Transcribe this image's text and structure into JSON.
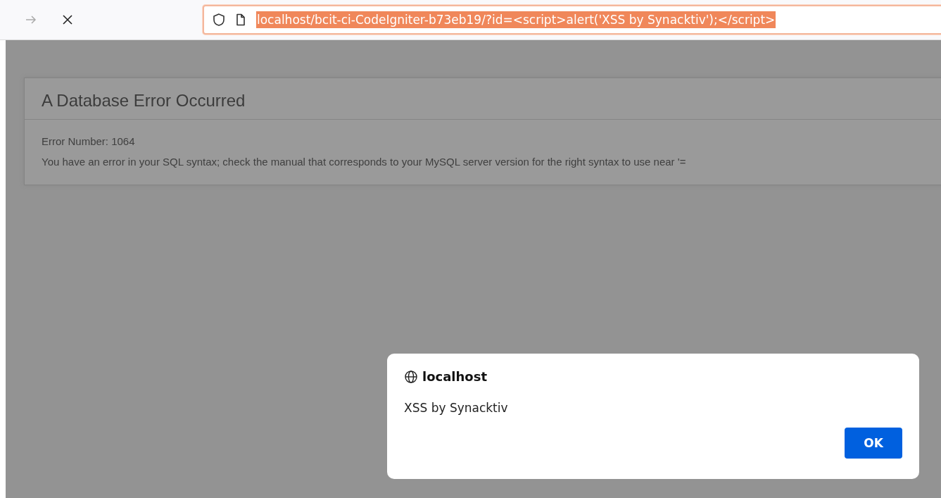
{
  "toolbar": {
    "nav_buttons": [
      {
        "kind": "forward",
        "disabled": true
      },
      {
        "kind": "stop",
        "disabled": false
      }
    ],
    "address_bar": {
      "url": "localhost/bcit-ci-CodeIgniter-b73eb19/?id=<script>alert('XSS by Synacktiv');</script>",
      "selected": true
    }
  },
  "page": {
    "heading": "A Database Error Occurred",
    "lines": [
      "Error Number: 1064",
      "You have an error in your SQL syntax; check the manual that corresponds to your MySQL server version for the right syntax to use near '="
    ]
  },
  "dialog": {
    "origin": "localhost",
    "message": "XSS by Synacktiv",
    "button": "OK"
  }
}
